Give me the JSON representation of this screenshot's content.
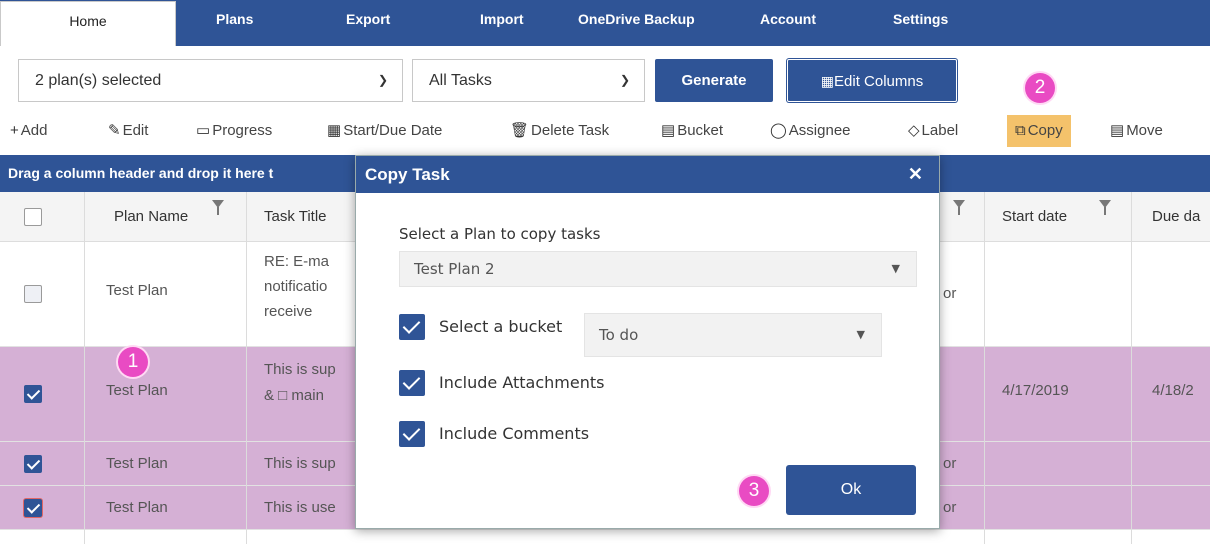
{
  "nav": {
    "tabs": [
      "Home",
      "Plans",
      "Export",
      "Import",
      "OneDrive Backup",
      "Account",
      "Settings"
    ]
  },
  "filters": {
    "plans_selected": "2 plan(s) selected",
    "tasks_filter": "All Tasks",
    "generate_label": "Generate",
    "edit_columns_label": "Edit Columns"
  },
  "toolbar": {
    "add": "Add",
    "edit": "Edit",
    "progress": "Progress",
    "start_due": "Start/Due Date",
    "delete": "Delete Task",
    "bucket": "Bucket",
    "assignee": "Assignee",
    "label": "Label",
    "copy": "Copy",
    "move": "Move"
  },
  "group_bar": "Drag a column header and drop it here t",
  "grid": {
    "headers": {
      "plan_name": "Plan Name",
      "task_title": "Task Title",
      "start_date": "Start date",
      "due_date": "Due da"
    },
    "rows": [
      {
        "checked": false,
        "plan": "Test Plan",
        "title_lines": [
          "RE: E-ma",
          "notificatio",
          "receive"
        ],
        "trail": "or",
        "start": "",
        "due": ""
      },
      {
        "checked": true,
        "plan": "Test Plan",
        "title_lines": [
          "This is sup",
          "& □ main"
        ],
        "trail": "",
        "start": "4/17/2019",
        "due": "4/18/2"
      },
      {
        "checked": true,
        "plan": "Test Plan",
        "title_lines": [
          "This is sup"
        ],
        "trail": "or",
        "start": "",
        "due": ""
      },
      {
        "checked": true,
        "plan": "Test Plan",
        "title_lines": [
          "This is use"
        ],
        "trail": "or",
        "start": "",
        "due": ""
      }
    ]
  },
  "callouts": [
    "1",
    "2",
    "3"
  ],
  "dialog": {
    "title": "Copy Task",
    "close": "✕",
    "plan_prompt": "Select a Plan to copy tasks",
    "plan_value": "Test Plan 2",
    "bucket_label": "Select a bucket",
    "bucket_value": "To do",
    "attachments_label": "Include Attachments",
    "comments_label": "Include Comments",
    "ok_label": "Ok"
  },
  "colors": {
    "primary": "#2f5496",
    "selected_row": "#d5b0d5",
    "copy_highlight": "#f4c26b",
    "callout": "#e94bc3"
  }
}
